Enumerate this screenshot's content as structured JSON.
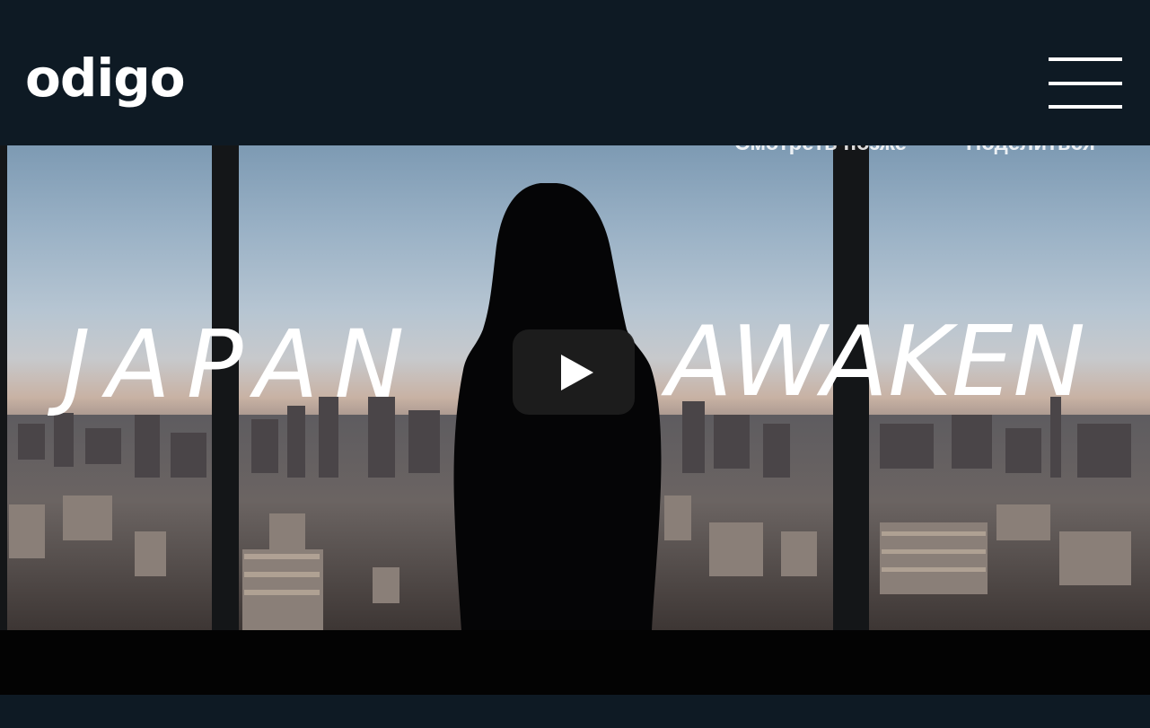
{
  "header": {
    "logo_text": "odigo",
    "menu_icon": "hamburger-menu-icon"
  },
  "video": {
    "actions": {
      "watch_later": "Смотреть позже",
      "share": "Поделиться"
    },
    "title_left": "JAPAN",
    "title_right": "AWAKEN",
    "play_icon": "play-icon"
  },
  "colors": {
    "header_background": "#0e1a24",
    "text": "#ffffff",
    "play_button": "#1e1e1e"
  }
}
